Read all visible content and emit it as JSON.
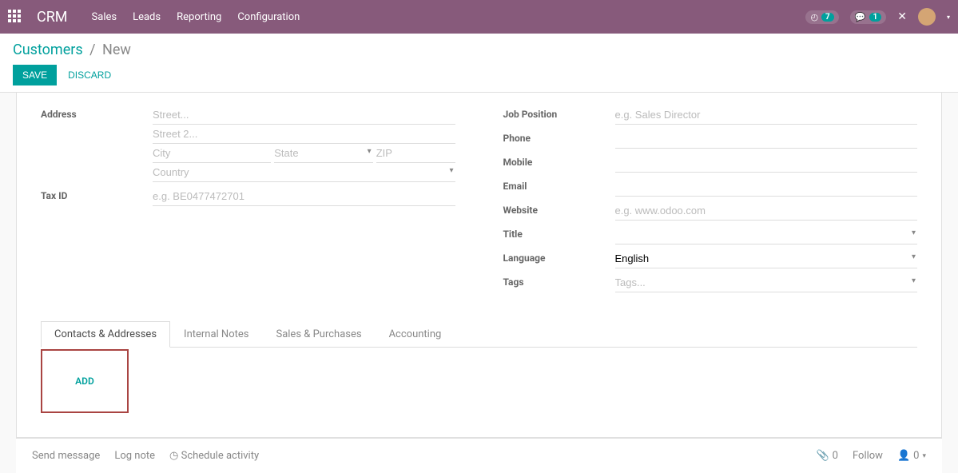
{
  "navbar": {
    "brand": "CRM",
    "menu": [
      "Sales",
      "Leads",
      "Reporting",
      "Configuration"
    ],
    "activities_count": "7",
    "messages_count": "1"
  },
  "breadcrumb": {
    "parent": "Customers",
    "current": "New"
  },
  "buttons": {
    "save": "SAVE",
    "discard": "DISCARD"
  },
  "left_fields": {
    "address_label": "Address",
    "street_ph": "Street...",
    "street2_ph": "Street 2...",
    "city_ph": "City",
    "state_ph": "State",
    "zip_ph": "ZIP",
    "country_ph": "Country",
    "taxid_label": "Tax ID",
    "taxid_ph": "e.g. BE0477472701"
  },
  "right_fields": {
    "jobpos_label": "Job Position",
    "jobpos_ph": "e.g. Sales Director",
    "phone_label": "Phone",
    "mobile_label": "Mobile",
    "email_label": "Email",
    "website_label": "Website",
    "website_ph": "e.g. www.odoo.com",
    "title_label": "Title",
    "language_label": "Language",
    "language_value": "English",
    "tags_label": "Tags",
    "tags_ph": "Tags..."
  },
  "tabs": [
    "Contacts & Addresses",
    "Internal Notes",
    "Sales & Purchases",
    "Accounting"
  ],
  "add_button": "ADD",
  "chatter": {
    "send": "Send message",
    "lognote": "Log note",
    "schedule": "Schedule activity",
    "attach_count": "0",
    "follow": "Follow",
    "follower_count": "0"
  }
}
